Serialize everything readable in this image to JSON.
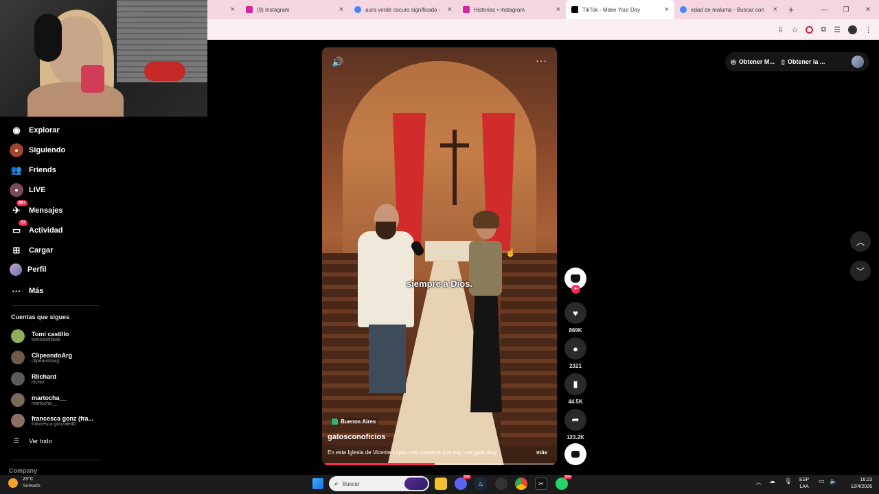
{
  "browser": {
    "tabs": [
      {
        "title": "",
        "favicon_color": "#ffffff",
        "active": false
      },
      {
        "title": "(9) Instagram",
        "favicon_color": "#d6249f",
        "active": false
      },
      {
        "title": "aura verde oscuro significado -",
        "favicon_color": "#4285f4",
        "active": false
      },
      {
        "title": "Historias • Instagram",
        "favicon_color": "#d6249f",
        "active": false
      },
      {
        "title": "TikTok - Make Your Day",
        "favicon_color": "#000000",
        "active": true
      },
      {
        "title": "edad de maluma - Buscar con",
        "favicon_color": "#4285f4",
        "active": false
      }
    ],
    "close_glyph": "×",
    "new_tab_glyph": "+"
  },
  "sidebar": {
    "items": [
      {
        "label": "Explorar",
        "icon": "compass-icon",
        "badge": ""
      },
      {
        "label": "Siguiendo",
        "icon": "following-avatar-icon",
        "badge": ""
      },
      {
        "label": "Friends",
        "icon": "friends-icon",
        "badge": ""
      },
      {
        "label": "LIVE",
        "icon": "live-icon",
        "badge": ""
      },
      {
        "label": "Mensajes",
        "icon": "messages-icon",
        "badge": "99+"
      },
      {
        "label": "Actividad",
        "icon": "activity-icon",
        "badge": "77"
      },
      {
        "label": "Cargar",
        "icon": "upload-icon",
        "badge": ""
      },
      {
        "label": "Perfil",
        "icon": "profile-icon",
        "badge": ""
      },
      {
        "label": "Más",
        "icon": "more-icon",
        "badge": ""
      }
    ],
    "following_title": "Cuentas que sigues",
    "following": [
      {
        "name": "Tomi castillo",
        "handle": "tomicastillook",
        "color": "#8fae5a"
      },
      {
        "name": "ClipeandoArg",
        "handle": "clipeandoarg",
        "color": "#6f5a49"
      },
      {
        "name": "Rlichard",
        "handle": "rlichtv",
        "color": "#5b5b5b"
      },
      {
        "name": "martocha__",
        "handle": "martocha__",
        "color": "#7a6a5a"
      },
      {
        "name": "francesca gonz (fra...",
        "handle": "francesca.gonzale40",
        "color": "#8a6f66"
      }
    ],
    "see_all": "Ver todo",
    "company": "Company"
  },
  "video": {
    "caption": "siempre a Dios.",
    "location": "Buenos Aires",
    "author": "gatosconoficios",
    "description": "En esta Iglesia de Vicente López nos contaron que hay una gata muy",
    "more_label": "más",
    "progress": 0.48
  },
  "actions": {
    "likes": "869K",
    "comments": "2321",
    "saves": "44.5K",
    "shares": "123.2K"
  },
  "top_actions": {
    "get_coins": "Obtener M...",
    "get_app": "Obtener la ..."
  },
  "taskbar": {
    "temperature": "23°C",
    "condition": "Soleado",
    "search_placeholder": "Buscar",
    "lang_line1": "ESP",
    "lang_line2": "LAA",
    "time": "16:23",
    "date": "12/4/2026",
    "discord_badge": "99+",
    "whatsapp_badge": "99+"
  },
  "colors": {
    "accent": "#fe2c55",
    "tabbar": "#f5d6e0",
    "background": "#000000"
  }
}
